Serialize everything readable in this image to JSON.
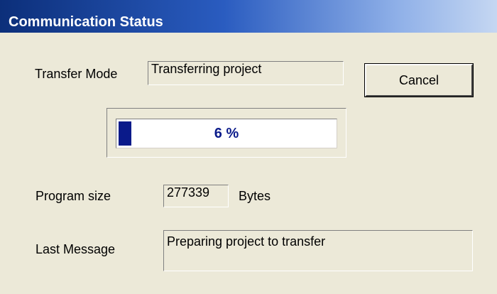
{
  "window": {
    "title": "Communication Status"
  },
  "transfer": {
    "label": "Transfer Mode",
    "value": "Transferring project"
  },
  "cancel": {
    "label": "Cancel"
  },
  "progress": {
    "percent": 6,
    "text": "6 %"
  },
  "program_size": {
    "label": "Program size",
    "value": "277339",
    "unit": "Bytes"
  },
  "last_message": {
    "label": "Last Message",
    "value": "Preparing project to transfer"
  },
  "colors": {
    "title_bar_start": "#0c2f7a",
    "progress_fill": "#0a1a8a",
    "dialog_bg": "#ece9d8"
  }
}
